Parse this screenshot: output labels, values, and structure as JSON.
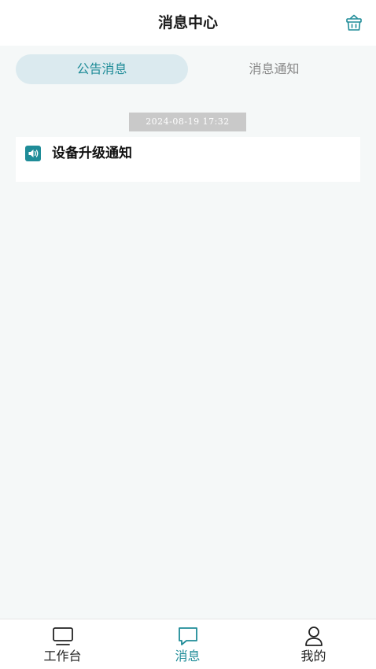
{
  "header": {
    "title": "消息中心",
    "action_icon": "basket-icon"
  },
  "tabs": [
    {
      "label": "公告消息",
      "active": true
    },
    {
      "label": "消息通知",
      "active": false
    }
  ],
  "messages": [
    {
      "timestamp": "2024-08-19 17:32",
      "icon": "speaker-icon",
      "title": "设备升级通知"
    }
  ],
  "tabbar": [
    {
      "label": "工作台",
      "icon": "monitor-icon",
      "active": false
    },
    {
      "label": "消息",
      "icon": "chat-bubble-icon",
      "active": true
    },
    {
      "label": "我的",
      "icon": "user-icon",
      "active": false
    }
  ],
  "colors": {
    "accent": "#1f8c98",
    "active_tab_bg": "#dbeaef",
    "page_bg": "#f5f8f8",
    "timestamp_bg": "#c9c9c9"
  }
}
